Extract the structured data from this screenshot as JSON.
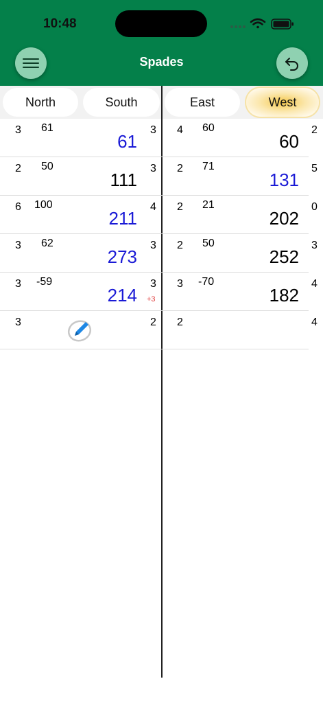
{
  "status": {
    "time": "10:48"
  },
  "header": {
    "title": "Spades",
    "menu_icon": "hamburger-icon",
    "undo_icon": "undo-arrow-icon"
  },
  "columns": [
    {
      "label": "North",
      "selected": false
    },
    {
      "label": "South",
      "selected": false
    },
    {
      "label": "East",
      "selected": false
    },
    {
      "label": "West",
      "selected": true
    }
  ],
  "rows": [
    {
      "north_bid": "3",
      "ns_points": "61",
      "ns_total": "61",
      "ns_total_blue": true,
      "south_bid": "3",
      "ns_bonus": "",
      "east_bid": "4",
      "ew_points": "60",
      "ew_total": "60",
      "ew_total_blue": false,
      "west_bid": "2"
    },
    {
      "north_bid": "2",
      "ns_points": "50",
      "ns_total": "111",
      "ns_total_blue": false,
      "south_bid": "3",
      "ns_bonus": "",
      "east_bid": "2",
      "ew_points": "71",
      "ew_total": "131",
      "ew_total_blue": true,
      "west_bid": "5"
    },
    {
      "north_bid": "6",
      "ns_points": "100",
      "ns_total": "211",
      "ns_total_blue": true,
      "south_bid": "4",
      "ns_bonus": "",
      "east_bid": "2",
      "ew_points": "21",
      "ew_total": "202",
      "ew_total_blue": false,
      "west_bid": "0"
    },
    {
      "north_bid": "3",
      "ns_points": "62",
      "ns_total": "273",
      "ns_total_blue": true,
      "south_bid": "3",
      "ns_bonus": "",
      "east_bid": "2",
      "ew_points": "50",
      "ew_total": "252",
      "ew_total_blue": false,
      "west_bid": "3"
    },
    {
      "north_bid": "3",
      "ns_points": "-59",
      "ns_total": "214",
      "ns_total_blue": true,
      "south_bid": "3",
      "ns_bonus": "+3",
      "east_bid": "3",
      "ew_points": "-70",
      "ew_total": "182",
      "ew_total_blue": false,
      "west_bid": "4"
    },
    {
      "north_bid": "3",
      "ns_points": "",
      "ns_total": "",
      "ns_total_blue": false,
      "south_bid": "2",
      "ns_bonus": "",
      "east_bid": "2",
      "ew_points": "",
      "ew_total": "",
      "ew_total_blue": false,
      "west_bid": "4",
      "edit_icon": "edit-pencil-icon"
    }
  ],
  "colors": {
    "header_green": "#04804a",
    "button_green": "#8fd1b1",
    "total_blue": "#1a1ad6",
    "bonus_red": "#e04040",
    "selected_gold": "#f5c84c"
  }
}
